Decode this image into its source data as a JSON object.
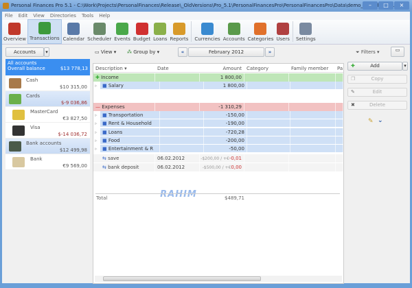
{
  "window": {
    "title": "Personal Finances Pro 5.1 - C:\\Work\\Projects\\PersonalFinances\\Release\\_OldVersions\\Pro_5.1\\PersonalFinancesPro\\PersonalFinancesPro\\Data\\demo_english.pfd..."
  },
  "menu": [
    "File",
    "Edit",
    "View",
    "Directories",
    "Tools",
    "Help"
  ],
  "toolbar": [
    {
      "label": "Overview",
      "icon": "overview-icon",
      "color": "#c0392b"
    },
    {
      "label": "Transactions",
      "icon": "book-icon",
      "color": "#3c9a3c",
      "active": true
    },
    {
      "label": "Calendar",
      "icon": "calendar-icon",
      "color": "#5a7aa8"
    },
    {
      "label": "Scheduler",
      "icon": "clock-icon",
      "color": "#6a8a6a"
    },
    {
      "label": "Events",
      "icon": "events-icon",
      "color": "#4aa84a"
    },
    {
      "label": "Budget",
      "icon": "piggy-bank-icon",
      "color": "#d03030"
    },
    {
      "label": "Loans",
      "icon": "loans-icon",
      "color": "#8ab04a"
    },
    {
      "label": "Reports",
      "icon": "reports-icon",
      "color": "#d89a2a"
    },
    {
      "label": "Currencies",
      "icon": "currencies-icon",
      "color": "#3a8ad0"
    },
    {
      "label": "Accounts",
      "icon": "accounts-icon",
      "color": "#5a9a4a"
    },
    {
      "label": "Categories",
      "icon": "categories-icon",
      "color": "#e0702a"
    },
    {
      "label": "Users",
      "icon": "users-icon",
      "color": "#b04040"
    },
    {
      "label": "Settings",
      "icon": "settings-icon",
      "color": "#7a8aa0"
    }
  ],
  "subtoolbar": {
    "accounts": "Accounts",
    "view": "View",
    "group_by": "Group by",
    "period": "February 2012",
    "filters": "Filters"
  },
  "accounts_panel": {
    "all_label": "All accounts",
    "overall_label": "Overall balance",
    "overall_value": "$13 778,13",
    "items": [
      {
        "name": "Cash",
        "value": "$10 315,00",
        "group": false,
        "sub": false,
        "color": "#a87a4a"
      },
      {
        "name": "Cards",
        "value": "$-9 036,86",
        "group": true,
        "sub": false,
        "negative": true,
        "color": "#6ab04a"
      },
      {
        "name": "MasterCard",
        "value": "€3 827,50",
        "group": false,
        "sub": true,
        "color": "#e0c040"
      },
      {
        "name": "Visa",
        "value": "$-14 036,72",
        "group": false,
        "sub": true,
        "negative": true,
        "color": "#333"
      },
      {
        "name": "Bank accounts",
        "value": "$12 499,98",
        "group": true,
        "sub": false,
        "color": "#4a5a4a"
      },
      {
        "name": "Bank",
        "value": "€9 569,00",
        "group": false,
        "sub": true,
        "color": "#d8c8a0"
      }
    ]
  },
  "grid": {
    "columns": [
      "Description ▾",
      "Date",
      "Amount",
      "Category",
      "Family member",
      "Pa"
    ],
    "rows": [
      {
        "type": "inc",
        "desc": "Income",
        "date": "",
        "amount": "1 800,00"
      },
      {
        "type": "cat",
        "desc": "Salary",
        "date": "",
        "amount": "1 800,00"
      },
      {
        "type": "exp",
        "desc": "Expenses",
        "date": "",
        "amount": "-1 310,29"
      },
      {
        "type": "cat",
        "desc": "Transportation",
        "date": "",
        "amount": "-150,00"
      },
      {
        "type": "cat",
        "desc": "Rent & Household",
        "date": "",
        "amount": "-190,00"
      },
      {
        "type": "cat",
        "desc": "Loans",
        "date": "",
        "amount": "-720,28"
      },
      {
        "type": "cat",
        "desc": "Food",
        "date": "",
        "amount": "-200,00"
      },
      {
        "type": "cat",
        "desc": "Entertainment & R",
        "date": "",
        "amount": "-50,00"
      },
      {
        "type": "tx",
        "desc": "save",
        "date": "06.02.2012",
        "amount_small": "-$200,00 / +€",
        "amount": "-0,01"
      },
      {
        "type": "tx",
        "desc": "bank deposit",
        "date": "06.02.2012",
        "amount_small": "-$500,00 / +€",
        "amount": "0,00"
      }
    ],
    "total_label": "Total",
    "total_value": "$489,71"
  },
  "actions": {
    "add": "Add",
    "copy": "Copy",
    "edit": "Edit",
    "delete": "Delete"
  },
  "watermark": "RAHIM SOFTWARES"
}
